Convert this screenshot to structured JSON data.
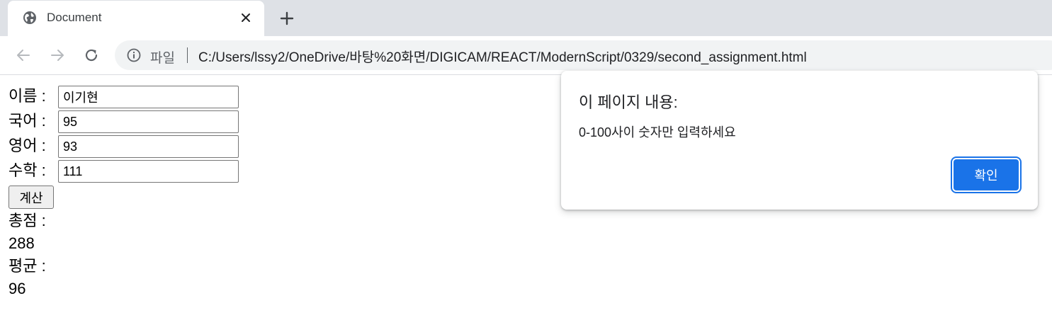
{
  "browser": {
    "tab": {
      "title": "Document",
      "icon": "globe-icon",
      "close_icon": "close-icon"
    },
    "new_tab_icon": "plus-icon",
    "nav": {
      "back_icon": "arrow-left-icon",
      "forward_icon": "arrow-right-icon",
      "reload_icon": "reload-icon"
    },
    "omnibox": {
      "security_icon": "info-icon",
      "security_label": "파일",
      "url": "C:/Users/lssy2/OneDrive/바탕%20화면/DIGICAM/REACT/ModernScript/0329/second_assignment.html"
    }
  },
  "form": {
    "fields": [
      {
        "label": "이름 :",
        "value": "이기현"
      },
      {
        "label": "국어 :",
        "value": "95"
      },
      {
        "label": "영어 :",
        "value": "93"
      },
      {
        "label": "수학 :",
        "value": "111"
      }
    ],
    "calc_button": "계산",
    "total_label": "총점 :",
    "total_value": "288",
    "average_label": "평균 :",
    "average_value": "96"
  },
  "dialog": {
    "title": "이 페이지 내용:",
    "message": "0-100사이 숫자만 입력하세요",
    "ok_button": "확인"
  },
  "colors": {
    "tabstrip_bg": "#dee1e6",
    "omnibox_bg": "#f1f3f4",
    "accent": "#1a73e8"
  }
}
